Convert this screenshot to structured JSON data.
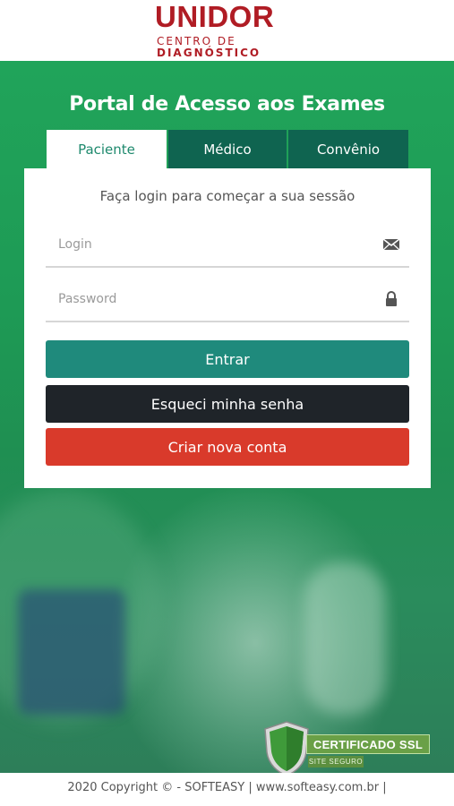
{
  "logo": {
    "main": "UNIDOR",
    "line1": "CENTRO DE",
    "line2": "DIAGNÓSTICO",
    "color": "#b01c24"
  },
  "portal": {
    "title": "Portal de Acesso aos Exames"
  },
  "tabs": [
    {
      "label": "Paciente",
      "active": true
    },
    {
      "label": "Médico",
      "active": false
    },
    {
      "label": "Convênio",
      "active": false
    }
  ],
  "form": {
    "subtitle": "Faça login para começar a sua sessão",
    "login_placeholder": "Login",
    "password_placeholder": "Password",
    "login_icon": "envelope-icon",
    "password_icon": "lock-icon"
  },
  "buttons": {
    "enter": "Entrar",
    "forgot": "Esqueci minha senha",
    "create": "Criar nova conta"
  },
  "ssl_badge": {
    "label": "CERTIFICADO SSL",
    "sub": "SITE SEGURO"
  },
  "footer": {
    "text": "2020 Copyright © - SOFTEASY | www.softeasy.com.br |"
  },
  "colors": {
    "accent_teal": "#1f8a7c",
    "tab_inactive": "#0f6450",
    "dark_button": "#1f2429",
    "red_button": "#d93a2b",
    "brand_red": "#b01c24"
  }
}
